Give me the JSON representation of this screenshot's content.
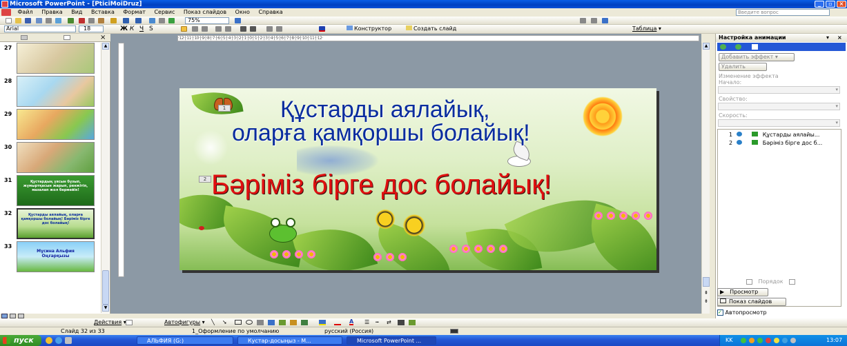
{
  "window": {
    "title": "Microsoft PowerPoint - [PticiMoiDruz]"
  },
  "menu": {
    "items": [
      "Файл",
      "Правка",
      "Вид",
      "Вставка",
      "Формат",
      "Сервис",
      "Показ слайдов",
      "Окно",
      "Справка"
    ],
    "help_placeholder": "Введите вопрос"
  },
  "toolbar": {
    "zoom": "75%",
    "font_name": "Arial",
    "font_size": "18",
    "designer": "Конструктор",
    "new_slide": "Создать слайд",
    "table": "Таблица"
  },
  "ruler": {
    "marks": "·12·|·11·|·10·|·9·|·8·|·7·|·6·|·5·|·4·|·3·|·2·|·1·|·0·|·1·|·2·|·3·|·4·|·5·|·6·|·7·|·8·|·9·|·10·|·11·|·12·"
  },
  "thumbnails": [
    {
      "num": "27",
      "label": ""
    },
    {
      "num": "28",
      "label": ""
    },
    {
      "num": "29",
      "label": ""
    },
    {
      "num": "30",
      "label": ""
    },
    {
      "num": "31",
      "label": "Құстардың ұясын бұзып, жұмыртқасын жарып, ренжітіп, мазалап жол бермейік!"
    },
    {
      "num": "32",
      "label": "Құстарды аялайық, оларға қамқоршы болайық! Бәріміз бірге дос болайық!"
    },
    {
      "num": "33",
      "label": "Мұсина Альфия Оңғарқызы"
    }
  ],
  "slide": {
    "title_line1": "Құстарды аялайық,",
    "title_line2": "оларға қамқоршы болайық!",
    "subtitle": "Бәріміз бірге дос болайық!",
    "anim_tag1": "1",
    "anim_tag2": "2"
  },
  "taskpane": {
    "title": "Настройка анимации",
    "add_effect": "Добавить эффект",
    "remove": "Удалить",
    "modify_header": "Изменение эффекта",
    "start_label": "Начало:",
    "property_label": "Свойство:",
    "speed_label": "Скорость:",
    "effects": [
      {
        "num": "1",
        "label": "Құстарды аялайы..."
      },
      {
        "num": "2",
        "label": "Бәріміз бірге дос б..."
      }
    ],
    "order_label": "Порядок",
    "preview": "Просмотр",
    "slideshow": "Показ слайдов",
    "autopreview": "Автопросмотр"
  },
  "drawing": {
    "actions": "Действия",
    "autoshapes": "Автофигуры"
  },
  "status": {
    "slide": "Слайд 32 из 33",
    "design": "1_Оформление по умолчанию",
    "language": "русский (Россия)"
  },
  "taskbar": {
    "start": "пуск",
    "tasks": [
      "АЛЬФИЯ (G:)",
      "Кустар-досыңыз - М...",
      "Microsoft PowerPoint ..."
    ],
    "lang": "KK",
    "time": "13:07"
  },
  "colors": {
    "title_bar": "#0a52d8",
    "slide_title": "#0a2d9e",
    "slide_subtitle": "#e01010",
    "taskbar": "#2458d6"
  }
}
